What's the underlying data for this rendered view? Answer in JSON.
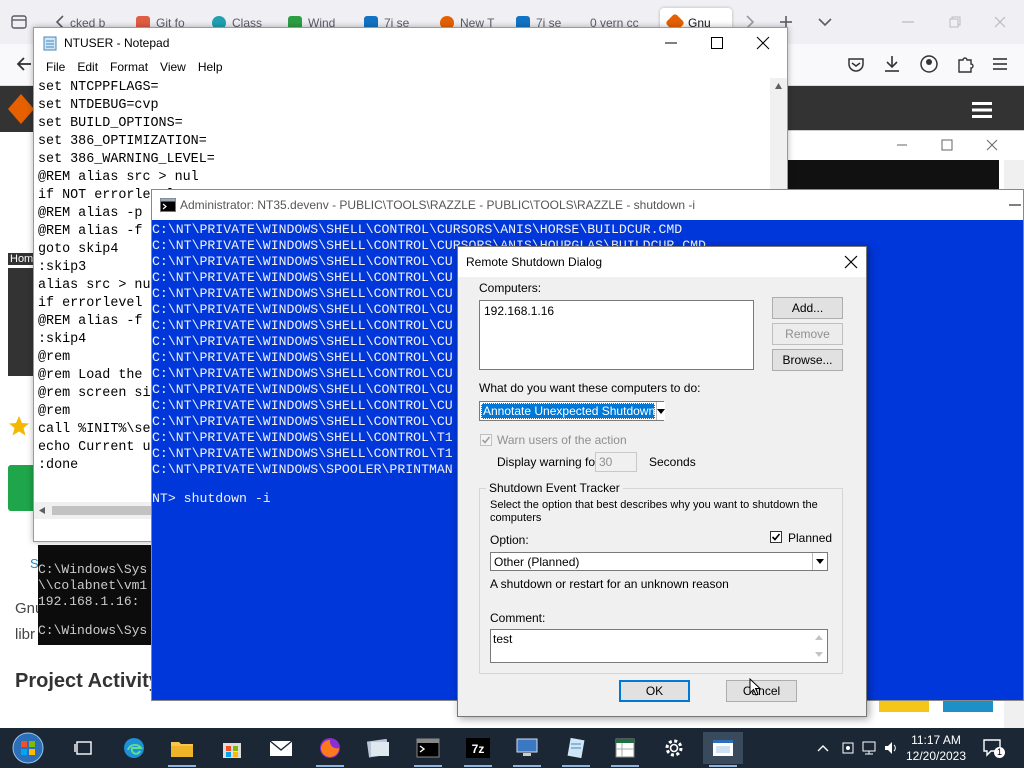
{
  "browser": {
    "tabs": [
      {
        "label": "cked b",
        "fav_color": "#d44"
      },
      {
        "label": "Git fo",
        "fav_color": "#e05d44"
      },
      {
        "label": "Class",
        "fav_color": "#20a0b0"
      },
      {
        "label": "Wind",
        "fav_color": "#2e9e45"
      },
      {
        "label": "7i se",
        "fav_color": "#1273c4"
      },
      {
        "label": "New T",
        "fav_color": "#e66000"
      },
      {
        "label": "7i se",
        "fav_color": "#1273c4"
      },
      {
        "label": "0 vern cc",
        "fav_color": "#cccccc"
      },
      {
        "label": "Gnu",
        "fav_color": "#e66000"
      }
    ],
    "page": {
      "home_link": "Hom",
      "gnu_text": "Gnu",
      "lib_text": "libr",
      "s_link": "S",
      "project_activity": "Project Activity"
    }
  },
  "notepad": {
    "title": "NTUSER - Notepad",
    "menu": [
      "File",
      "Edit",
      "Format",
      "View",
      "Help"
    ],
    "lines": [
      "set NTCPPFLAGS=",
      "set NTDEBUG=cvp",
      "set BUILD_OPTIONS=",
      "set 386_OPTIMIZATION=",
      "set 386_WARNING_LEVEL=",
      "@REM alias src > nul",
      "if NOT errorlevel",
      "@REM alias -p",
      "@REM alias -f",
      "goto skip4",
      ":skip3",
      "alias src > nul",
      "if errorlevel",
      "@REM alias -f",
      ":skip4",
      "@rem",
      "@rem Load the",
      "@rem screen si",
      "@rem",
      "call %INIT%\\se",
      "echo Current u",
      ":done"
    ]
  },
  "small_cmd": {
    "lines": [
      "C:\\Windows\\Sys",
      "\\\\colabnet\\vm1",
      "192.168.1.16:",
      "",
      "C:\\Windows\\Sys"
    ]
  },
  "console": {
    "title": "Administrator:  NT35.devenv  - PUBLIC\\TOOLS\\RAZZLE - PUBLIC\\TOOLS\\RAZZLE  - shutdown  -i",
    "lines": [
      "C:\\NT\\PRIVATE\\WINDOWS\\SHELL\\CONTROL\\CURSORS\\ANIS\\HORSE\\BUILDCUR.CMD",
      "C:\\NT\\PRIVATE\\WINDOWS\\SHELL\\CONTROL\\CURSORS\\ANIS\\HOURGLAS\\BUILDCUR.CMD",
      "C:\\NT\\PRIVATE\\WINDOWS\\SHELL\\CONTROL\\CU",
      "C:\\NT\\PRIVATE\\WINDOWS\\SHELL\\CONTROL\\CU",
      "C:\\NT\\PRIVATE\\WINDOWS\\SHELL\\CONTROL\\CU",
      "C:\\NT\\PRIVATE\\WINDOWS\\SHELL\\CONTROL\\CU",
      "C:\\NT\\PRIVATE\\WINDOWS\\SHELL\\CONTROL\\CU",
      "C:\\NT\\PRIVATE\\WINDOWS\\SHELL\\CONTROL\\CU",
      "C:\\NT\\PRIVATE\\WINDOWS\\SHELL\\CONTROL\\CU",
      "C:\\NT\\PRIVATE\\WINDOWS\\SHELL\\CONTROL\\CU",
      "C:\\NT\\PRIVATE\\WINDOWS\\SHELL\\CONTROL\\CU",
      "C:\\NT\\PRIVATE\\WINDOWS\\SHELL\\CONTROL\\CU",
      "C:\\NT\\PRIVATE\\WINDOWS\\SHELL\\CONTROL\\CU",
      "C:\\NT\\PRIVATE\\WINDOWS\\SHELL\\CONTROL\\T1",
      "C:\\NT\\PRIVATE\\WINDOWS\\SHELL\\CONTROL\\T1",
      "C:\\NT\\PRIVATE\\WINDOWS\\SPOOLER\\PRINTMAN",
      "",
      "NT> shutdown -i"
    ]
  },
  "dialog": {
    "title": "Remote Shutdown Dialog",
    "computers_label": "Computers:",
    "computers": [
      "192.168.1.16"
    ],
    "add_button": "Add...",
    "remove_button": "Remove",
    "browse_button": "Browse...",
    "action_label": "What do you want these computers to do:",
    "action_value": "Annotate Unexpected Shutdown",
    "warn_label": "Warn users of the action",
    "warn_checked": true,
    "display_warning_label": "Display warning for",
    "warning_seconds": "30",
    "seconds_label": "Seconds",
    "tracker_group": "Shutdown Event Tracker",
    "tracker_description": "Select the option that best describes why you want to shutdown the computers",
    "option_label": "Option:",
    "planned_label": "Planned",
    "planned_checked": true,
    "option_value": "Other (Planned)",
    "option_description": "A shutdown or restart for an unknown reason",
    "comment_label": "Comment:",
    "comment_value": "test",
    "ok_button": "OK",
    "cancel_button": "Cancel"
  },
  "taskbar": {
    "time": "11:17 AM",
    "date": "12/20/2023",
    "notification_count": "1",
    "colors": {
      "bg": "#1b2735",
      "accent": "#8fb4de"
    }
  },
  "colors": {
    "console_bg": "#0037da",
    "selection": "#0078d7",
    "dialog_bg": "#f0f0f0"
  }
}
